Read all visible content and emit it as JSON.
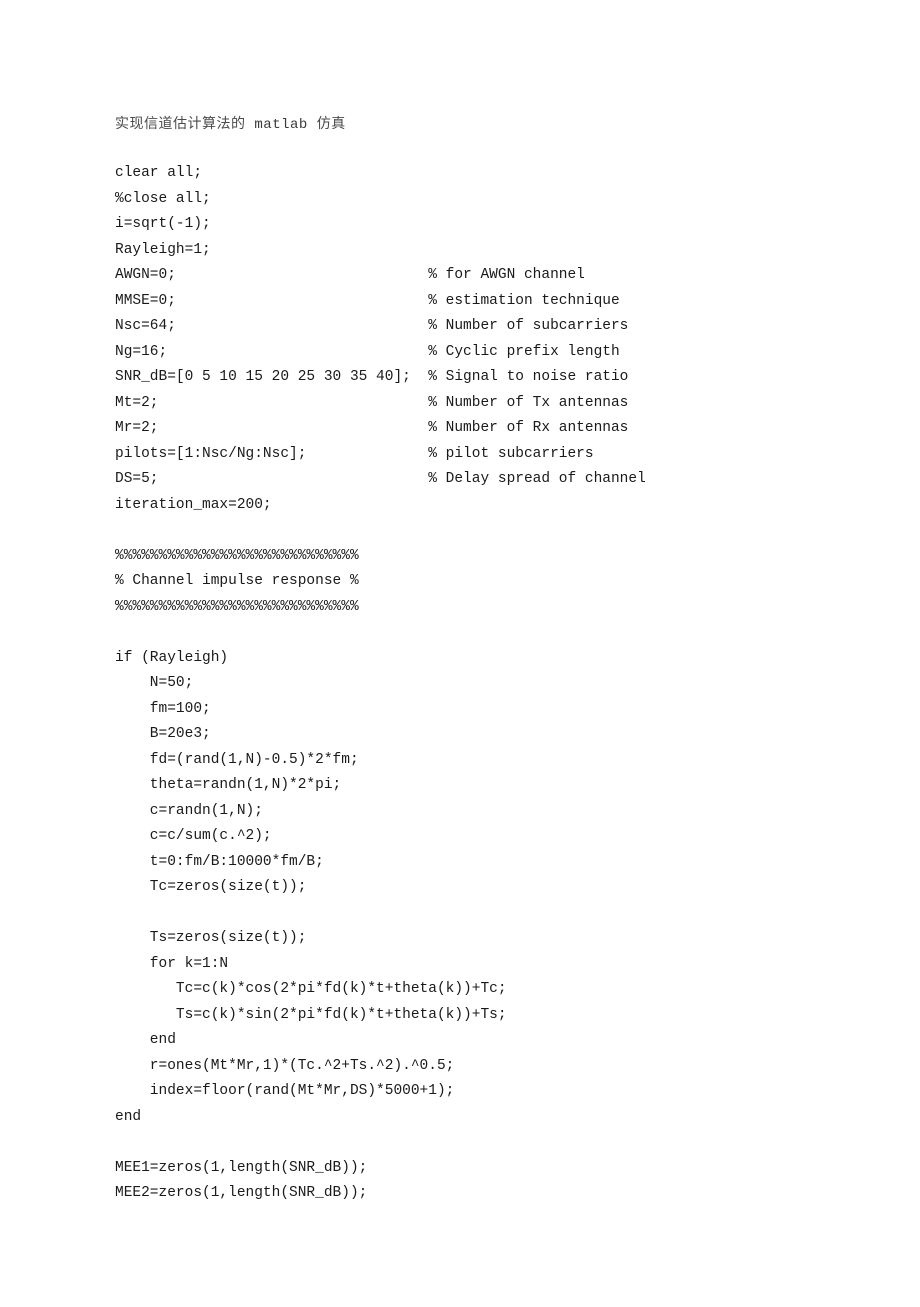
{
  "title": {
    "prefix_cn": "实现信道估计算法的",
    "latin": " matlab ",
    "suffix_cn": "仿真"
  },
  "code_lines": [
    "clear all;",
    "%close all;",
    "i=sqrt(-1);",
    "Rayleigh=1;",
    "AWGN=0;                             % for AWGN channel",
    "MMSE=0;                             % estimation technique",
    "Nsc=64;                             % Number of subcarriers",
    "Ng=16;                              % Cyclic prefix length",
    "SNR_dB=[0 5 10 15 20 25 30 35 40];  % Signal to noise ratio",
    "Mt=2;                               % Number of Tx antennas",
    "Mr=2;                               % Number of Rx antennas",
    "pilots=[1:Nsc/Ng:Nsc];              % pilot subcarriers",
    "DS=5;                               % Delay spread of channel",
    "iteration_max=200;",
    "",
    "%%%%%%%%%%%%%%%%%%%%%%%%%%%%",
    "% Channel impulse response %",
    "%%%%%%%%%%%%%%%%%%%%%%%%%%%%",
    "",
    "if (Rayleigh)",
    "    N=50;",
    "    fm=100;",
    "    B=20e3;",
    "    fd=(rand(1,N)-0.5)*2*fm;",
    "    theta=randn(1,N)*2*pi;",
    "    c=randn(1,N);",
    "    c=c/sum(c.^2);",
    "    t=0:fm/B:10000*fm/B;",
    "    Tc=zeros(size(t));",
    "",
    "    Ts=zeros(size(t));",
    "    for k=1:N",
    "       Tc=c(k)*cos(2*pi*fd(k)*t+theta(k))+Tc;",
    "       Ts=c(k)*sin(2*pi*fd(k)*t+theta(k))+Ts;",
    "    end",
    "    r=ones(Mt*Mr,1)*(Tc.^2+Ts.^2).^0.5;",
    "    index=floor(rand(Mt*Mr,DS)*5000+1);",
    "end",
    "",
    "MEE1=zeros(1,length(SNR_dB));",
    "MEE2=zeros(1,length(SNR_dB));"
  ]
}
